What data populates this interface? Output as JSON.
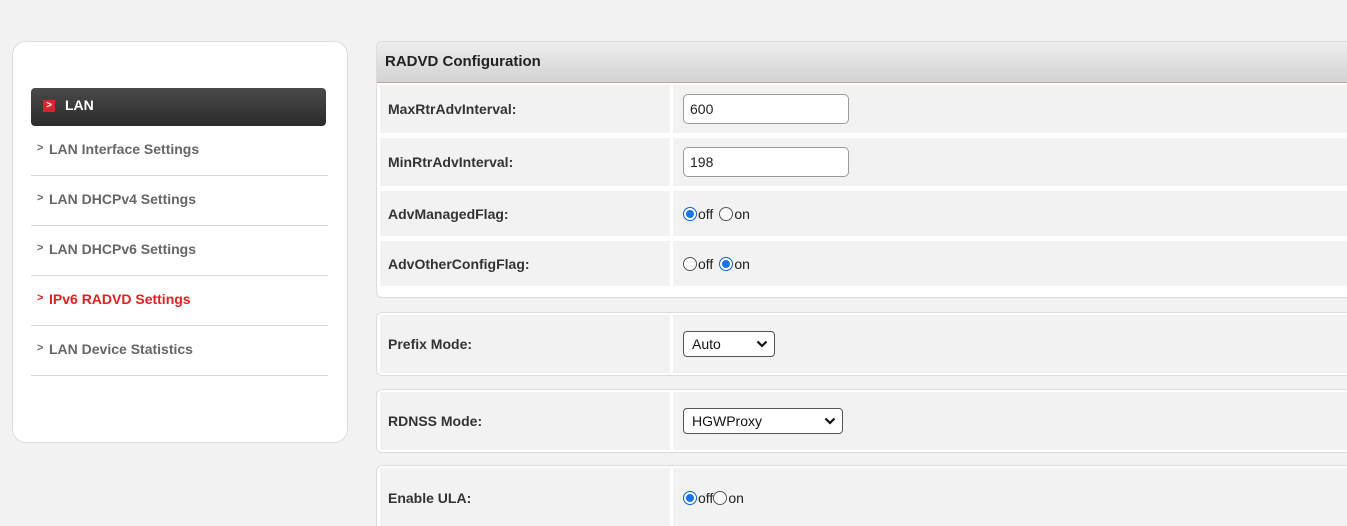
{
  "sidebar": {
    "header": "LAN",
    "header_badge": ">",
    "items": [
      {
        "label": "LAN Interface Settings",
        "active": false
      },
      {
        "label": "LAN DHCPv4 Settings",
        "active": false
      },
      {
        "label": "LAN DHCPv6 Settings",
        "active": false
      },
      {
        "label": "IPv6 RADVD Settings",
        "active": true
      },
      {
        "label": "LAN Device Statistics",
        "active": false
      }
    ],
    "arrow_glyph": ">"
  },
  "radvd": {
    "title": "RADVD Configuration",
    "max_interval_label": "MaxRtrAdvInterval:",
    "max_interval_value": "600",
    "min_interval_label": "MinRtrAdvInterval:",
    "min_interval_value": "198",
    "managed_flag_label": "AdvManagedFlag:",
    "managed_flag_value": "off",
    "other_config_label": "AdvOtherConfigFlag:",
    "other_config_value": "on",
    "off_label": "off",
    "on_label": "on"
  },
  "prefix": {
    "label": "Prefix Mode:",
    "value": "Auto"
  },
  "rdnss": {
    "label": "RDNSS Mode:",
    "value": "HGWProxy"
  },
  "ula": {
    "label": "Enable ULA:",
    "value": "off",
    "off_label": "off",
    "on_label": "on"
  },
  "colors": {
    "active_text": "#e02020",
    "badge": "#d9232d",
    "radio_checked": "#1a73e8"
  }
}
